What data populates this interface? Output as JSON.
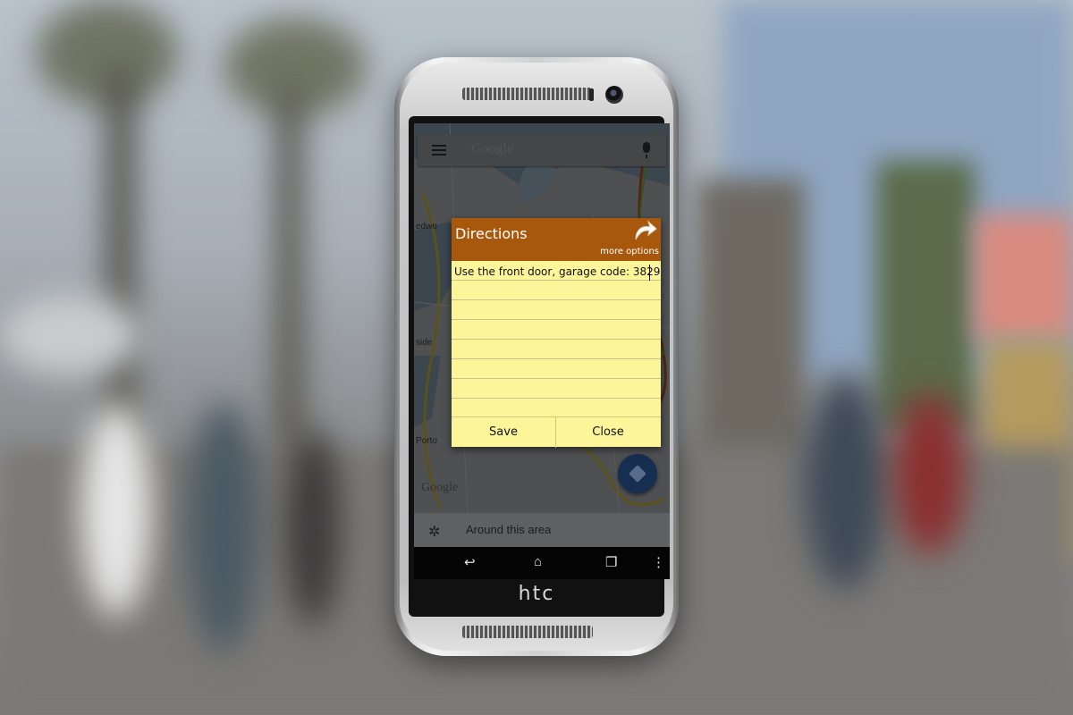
{
  "map": {
    "search_placeholder": "Google",
    "labels": [
      "edwo",
      "side",
      "Porto",
      "Google"
    ],
    "bottom_card_label": "Around this area"
  },
  "phone": {
    "brand": "htc"
  },
  "note": {
    "title": "Directions",
    "more_options": "more options",
    "text": "Use the front door, garage code: 3829",
    "save_label": "Save",
    "close_label": "Close",
    "colors": {
      "header": "#a8580d",
      "paper": "#fdf59a"
    }
  },
  "navbar": {
    "icons": [
      "back-icon",
      "home-icon",
      "recents-icon",
      "overflow-menu-icon"
    ]
  }
}
